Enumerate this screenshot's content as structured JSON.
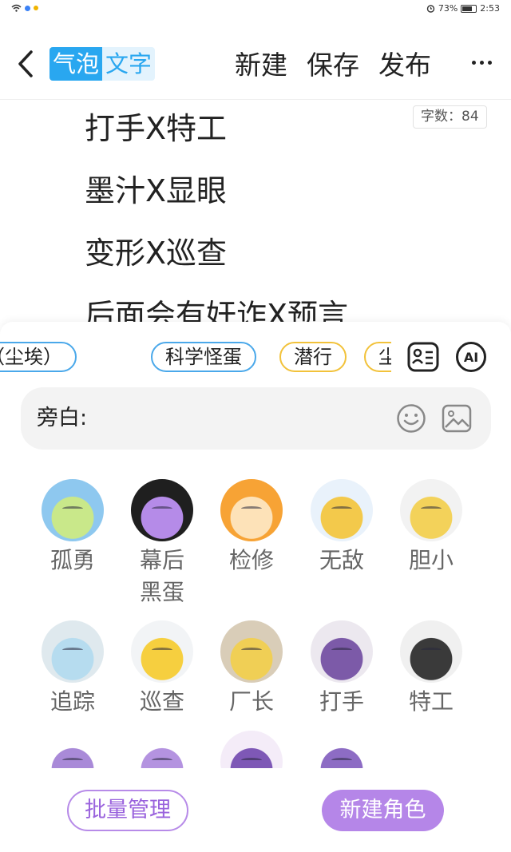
{
  "status_bar": {
    "battery": "73%",
    "time": "2:53"
  },
  "header": {
    "mode_active": "气泡",
    "mode_inactive": "文字",
    "new_label": "新建",
    "save_label": "保存",
    "publish_label": "发布"
  },
  "editor": {
    "word_count": "字数：84",
    "lines": [
      "打手X特工",
      "墨汁X显眼",
      "变形X巡查",
      "后面会有奸诈X预言"
    ]
  },
  "role_chips": [
    {
      "label": "魂（尘埃）",
      "color": "#4aa8ea"
    },
    {
      "label": "科学怪蛋",
      "color": "#4aa8ea"
    },
    {
      "label": "潜行",
      "color": "#f2c23a"
    },
    {
      "label": "尘",
      "color": "#f2c23a"
    }
  ],
  "narration": {
    "label": "旁白:"
  },
  "characters": [
    {
      "name": "孤勇",
      "icon": "avatar-guyong"
    },
    {
      "name": "幕后\n黑蛋",
      "icon": "avatar-muhou"
    },
    {
      "name": "检修",
      "icon": "avatar-jianxiu"
    },
    {
      "name": "无敌",
      "icon": "avatar-wudi"
    },
    {
      "name": "胆小",
      "icon": "avatar-danxiao"
    },
    {
      "name": "追踪",
      "icon": "avatar-zhuizong"
    },
    {
      "name": "巡查",
      "icon": "avatar-xuncha"
    },
    {
      "name": "厂长",
      "icon": "avatar-changzhang"
    },
    {
      "name": "打手",
      "icon": "avatar-dashou"
    },
    {
      "name": "特工",
      "icon": "avatar-tegong"
    },
    {
      "name": "",
      "icon": "avatar-purple-1"
    },
    {
      "name": "",
      "icon": "avatar-purple-2"
    },
    {
      "name": "",
      "icon": "avatar-purple-3"
    },
    {
      "name": "",
      "icon": "avatar-purple-4"
    }
  ],
  "actions": {
    "batch_manage": "批量管理",
    "new_role": "新建角色"
  },
  "colors": {
    "accent_blue": "#29a7f0",
    "accent_purple": "#b586e8"
  }
}
